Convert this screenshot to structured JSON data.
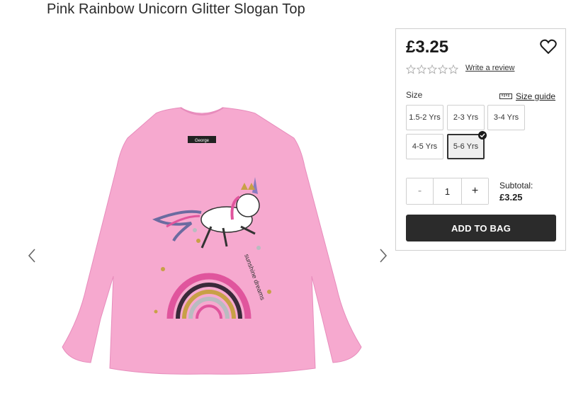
{
  "product": {
    "title": "Pink Rainbow Unicorn Glitter Slogan Top",
    "price": "£3.25",
    "review_link": "Write a review",
    "rating_stars": 0,
    "brand_label": "George",
    "slogan": "sunshine dreams"
  },
  "icons": {
    "wishlist": "heart-icon",
    "prev": "chevron-left-icon",
    "next": "chevron-right-icon",
    "size_guide": "ruler-icon",
    "selected": "check-icon",
    "star": "star-outline-icon"
  },
  "sizes": {
    "label": "Size",
    "guide_label": "Size guide",
    "options": [
      "1.5-2 Yrs",
      "2-3 Yrs",
      "3-4 Yrs",
      "4-5 Yrs",
      "5-6 Yrs"
    ],
    "selected": "5-6 Yrs"
  },
  "quantity": {
    "minus": "-",
    "value": "1",
    "plus": "+"
  },
  "subtotal": {
    "label": "Subtotal:",
    "value": "£3.25"
  },
  "cart": {
    "add_label": "ADD TO BAG"
  },
  "colors": {
    "shirt": "#f6a9cf",
    "button_bg": "#2b2b2b"
  }
}
